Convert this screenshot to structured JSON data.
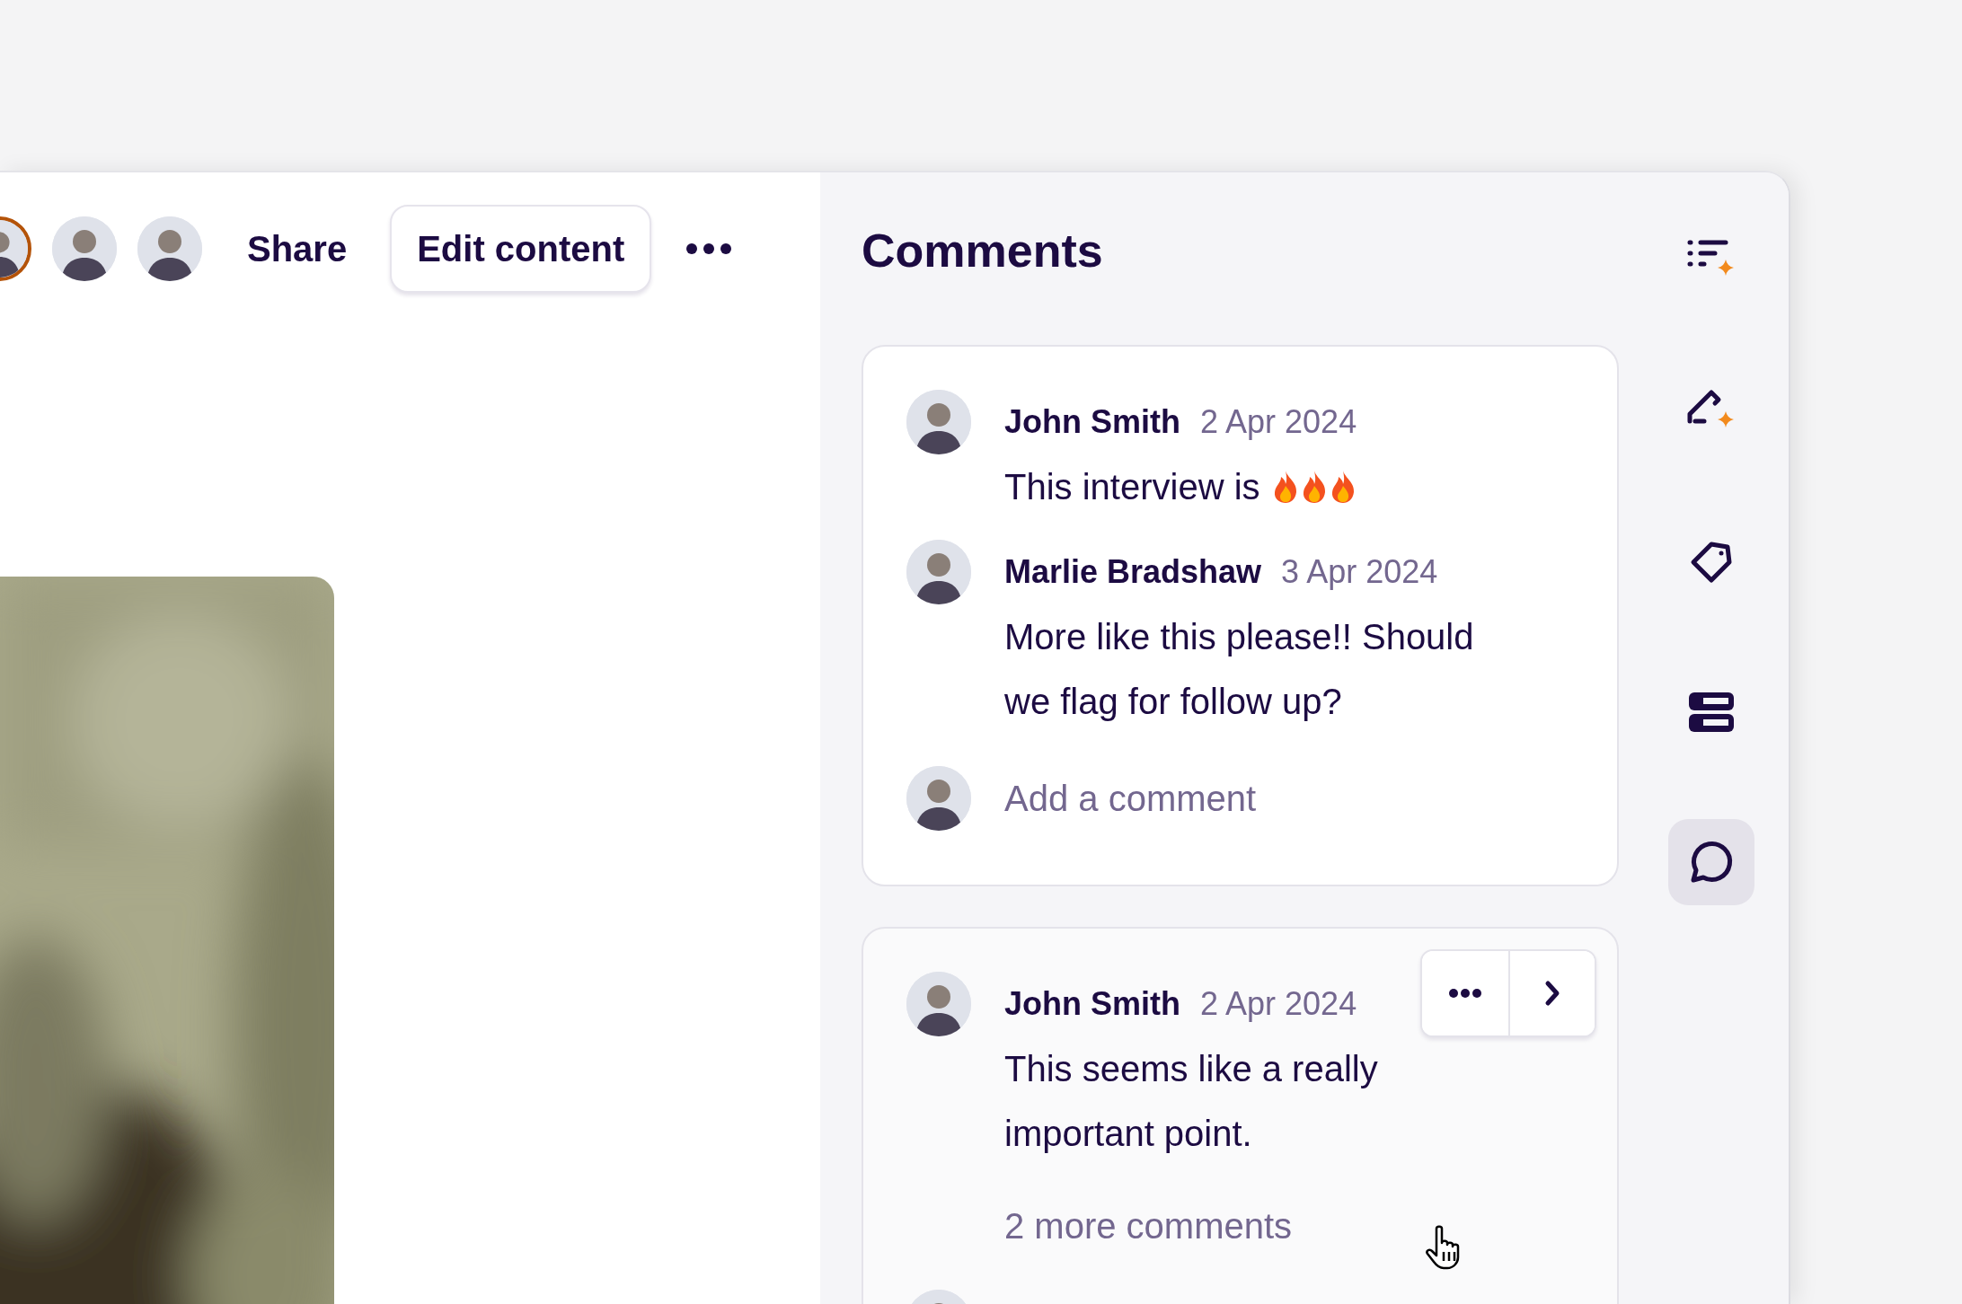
{
  "header": {
    "avatars": [
      {
        "active": true
      },
      {
        "active": false
      },
      {
        "active": false
      }
    ],
    "share": "Share",
    "edit_button": "Edit content"
  },
  "comments_panel": {
    "title": "Comments",
    "threads": [
      {
        "hovered": false,
        "comments": [
          {
            "author": "John Smith",
            "date": "2 Apr 2024",
            "body": "This interview is",
            "trailing_icons": [
              {
                "kind": "fire"
              },
              {
                "kind": "fire"
              },
              {
                "kind": "fire"
              }
            ]
          },
          {
            "author": "Marlie Bradshaw",
            "date": "3 Apr 2024",
            "body": "More like this please!! Should we flag for follow up?"
          }
        ],
        "reply_placeholder": "Add a comment",
        "peek_avatar": false
      },
      {
        "hovered": true,
        "comments": [
          {
            "author": "John Smith",
            "date": "2 Apr 2024",
            "body": "This seems like a really important point."
          }
        ],
        "more": "2 more comments",
        "peek_avatar": true
      }
    ]
  },
  "rail": [
    {
      "kind": "summary",
      "selected": false
    },
    {
      "kind": "edit",
      "selected": false
    },
    {
      "kind": "tag",
      "selected": false
    },
    {
      "kind": "stack",
      "selected": false
    },
    {
      "kind": "comment",
      "selected": true
    }
  ]
}
